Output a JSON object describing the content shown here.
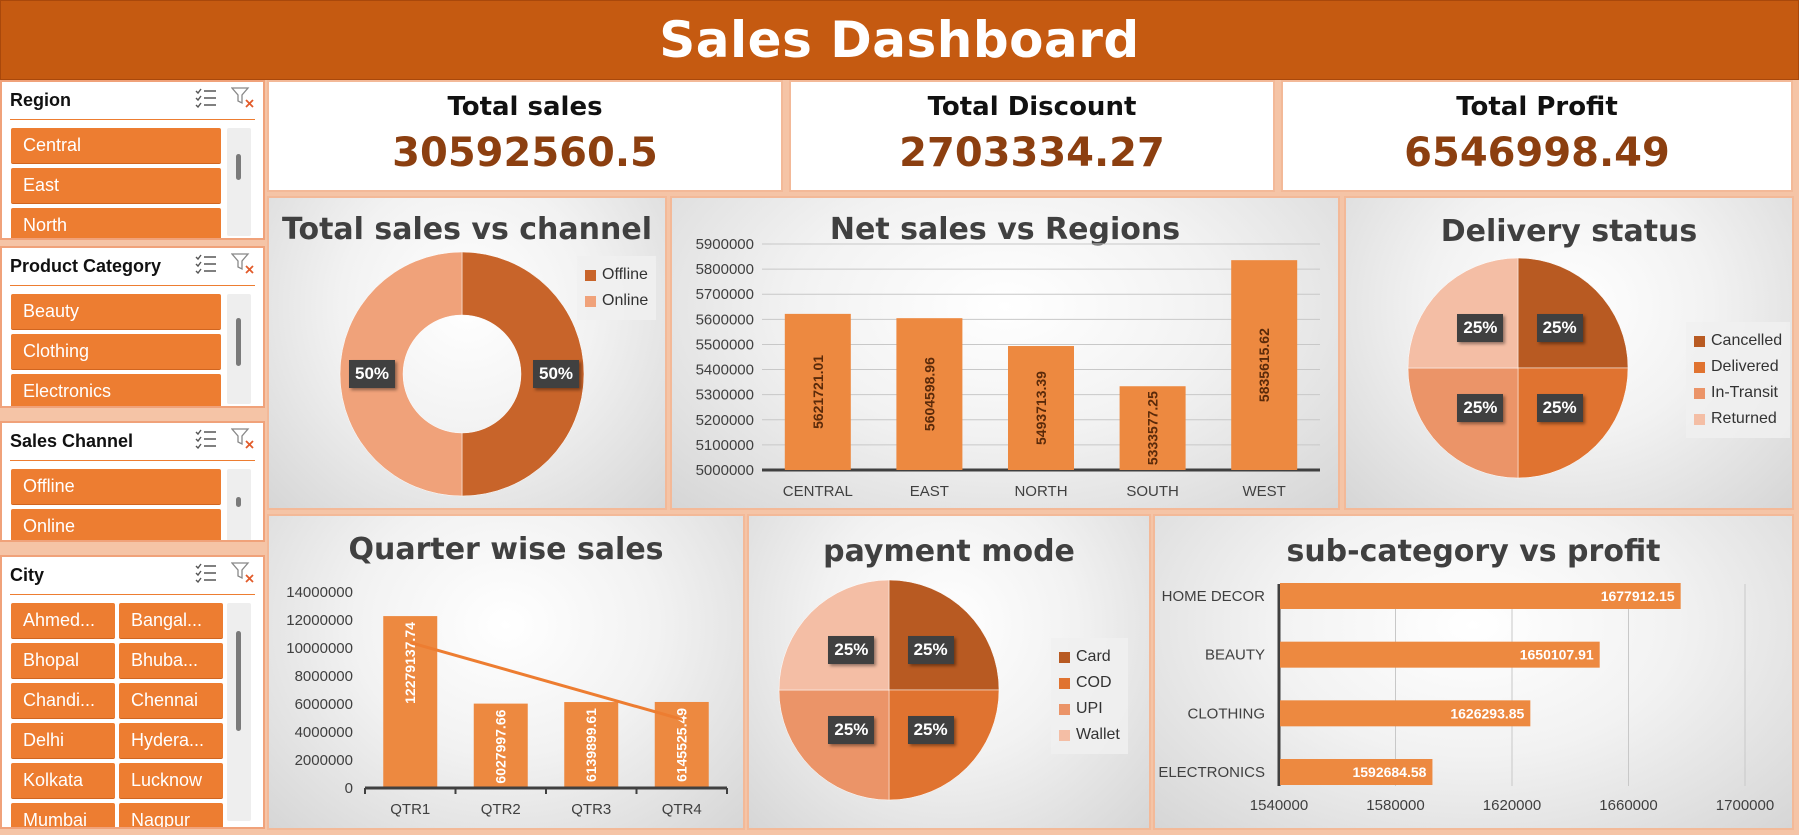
{
  "header": {
    "title": "Sales Dashboard"
  },
  "slicers": {
    "region": {
      "title": "Region",
      "items": [
        "Central",
        "East",
        "North"
      ]
    },
    "product_category": {
      "title": "Product Category",
      "items": [
        "Beauty",
        "Clothing",
        "Electronics"
      ]
    },
    "sales_channel": {
      "title": "Sales Channel",
      "items": [
        "Offline",
        "Online"
      ]
    },
    "city": {
      "title": "City",
      "items": [
        "Ahmed...",
        "Bangal...",
        "Bhopal",
        "Bhuba...",
        "Chandi...",
        "Chennai",
        "Delhi",
        "Hydera...",
        "Kolkata",
        "Lucknow",
        "Mumbai",
        "Nagpur"
      ]
    },
    "icons": {
      "multi_select": "multi-select-icon",
      "clear_filter": "clear-filter-icon"
    }
  },
  "kpis": {
    "total_sales": {
      "label": "Total sales",
      "value": "30592560.5"
    },
    "total_discount": {
      "label": "Total Discount",
      "value": "2703334.27"
    },
    "total_profit": {
      "label": "Total Profit",
      "value": "6546998.49"
    }
  },
  "colors": {
    "header": "#c55a11",
    "accent": "#ed7d31",
    "dark_orange": "#c0602a",
    "mid_orange": "#e8824a",
    "light_orange": "#f0a27a",
    "pale_orange": "#f6c7ae",
    "kpi_value": "#8c3f10"
  },
  "chart_data": [
    {
      "id": "channel",
      "type": "pie",
      "donut": true,
      "title": "Total sales vs channel",
      "labels": [
        "Offline",
        "Online"
      ],
      "values": [
        50,
        50
      ],
      "data_labels": [
        "50%",
        "50%"
      ],
      "colors": [
        "#c8642a",
        "#f0a27a"
      ],
      "legend": "top-right"
    },
    {
      "id": "regions",
      "type": "bar",
      "title": "Net sales vs Regions",
      "categories": [
        "CENTRAL",
        "EAST",
        "NORTH",
        "SOUTH",
        "WEST"
      ],
      "values": [
        5621721.01,
        5604598.96,
        5493713.39,
        5333577.25,
        5835615.62
      ],
      "data_labels": [
        "5621721.01",
        "5604598.96",
        "5493713.39",
        "5333577.25",
        "5835615.62"
      ],
      "ylim": [
        5000000,
        5900000
      ],
      "yticks": [
        "5000000",
        "5100000",
        "5200000",
        "5300000",
        "5400000",
        "5500000",
        "5600000",
        "5700000",
        "5800000",
        "5900000"
      ],
      "grid": true
    },
    {
      "id": "delivery",
      "type": "pie",
      "title": "Delivery status",
      "labels": [
        "Cancelled",
        "Delivered",
        "In-Transit",
        "Returned"
      ],
      "values": [
        25,
        25,
        25,
        25
      ],
      "data_labels": [
        "25%",
        "25%",
        "25%",
        "25%"
      ],
      "colors": [
        "#b85a22",
        "#e07330",
        "#eb9468",
        "#f4bea5"
      ],
      "legend": "right"
    },
    {
      "id": "quarter",
      "type": "bar",
      "title": "Quarter wise sales",
      "categories": [
        "QTR1",
        "QTR2",
        "QTR3",
        "QTR4"
      ],
      "values": [
        12279137.74,
        6027997.66,
        6139899.61,
        6145525.49
      ],
      "data_labels": [
        "12279137.74",
        "6027997.66",
        "6139899.61",
        "6145525.49"
      ],
      "trendline": true,
      "ylim": [
        0,
        14000000
      ],
      "yticks": [
        "0",
        "2000000",
        "4000000",
        "6000000",
        "8000000",
        "10000000",
        "12000000",
        "14000000"
      ]
    },
    {
      "id": "payment",
      "type": "pie",
      "title": "payment mode",
      "labels": [
        "Card",
        "COD",
        "UPI",
        "Wallet"
      ],
      "values": [
        25,
        25,
        25,
        25
      ],
      "data_labels": [
        "25%",
        "25%",
        "25%",
        "25%"
      ],
      "colors": [
        "#b85a22",
        "#e07330",
        "#eb9468",
        "#f4bea5"
      ],
      "legend": "right"
    },
    {
      "id": "subcat",
      "type": "bar",
      "orientation": "horizontal",
      "title": "sub-category vs profit",
      "categories": [
        "HOME DECOR",
        "BEAUTY",
        "CLOTHING",
        "ELECTRONICS"
      ],
      "values": [
        1677912.15,
        1650107.91,
        1626293.85,
        1592684.58
      ],
      "data_labels": [
        "1677912.15",
        "1650107.91",
        "1626293.85",
        "1592684.58"
      ],
      "xlim": [
        1540000,
        1700000
      ],
      "xticks": [
        "1540000",
        "1580000",
        "1620000",
        "1660000",
        "1700000"
      ],
      "grid": true
    }
  ]
}
